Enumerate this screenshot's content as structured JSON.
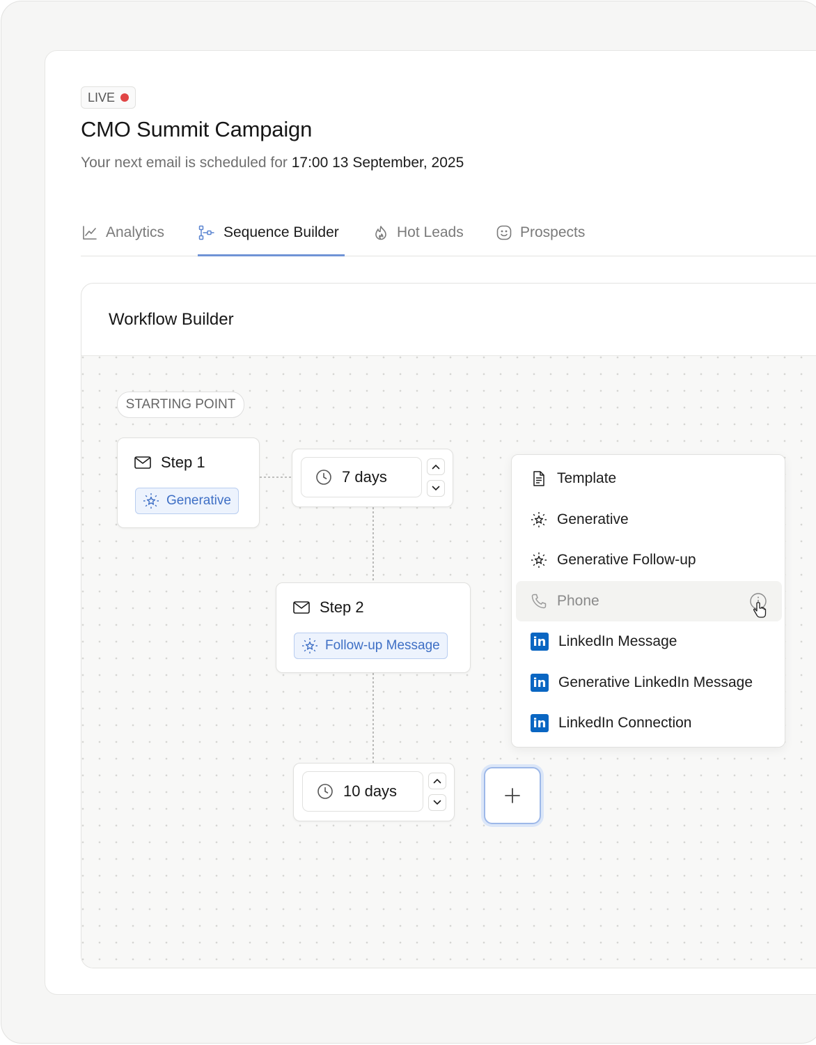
{
  "header": {
    "status_badge": "LIVE",
    "title": "CMO Summit Campaign",
    "schedule_prefix": "Your next email is scheduled for ",
    "schedule_time": "17:00 13 September, 2025"
  },
  "tabs": [
    {
      "label": "Analytics",
      "icon": "line-chart-icon",
      "active": false
    },
    {
      "label": "Sequence Builder",
      "icon": "workflow-icon",
      "active": true
    },
    {
      "label": "Hot Leads",
      "icon": "flame-icon",
      "active": false
    },
    {
      "label": "Prospects",
      "icon": "smiley-icon",
      "active": false
    }
  ],
  "workflow": {
    "title": "Workflow Builder",
    "starting_point": "STARTING POINT",
    "steps": [
      {
        "label": "Step 1",
        "tag": "Generative"
      },
      {
        "label": "Step 2",
        "tag": "Follow-up Message"
      }
    ],
    "delays": [
      "7 days",
      "10 days"
    ],
    "add_button": "+"
  },
  "menu": {
    "items": [
      {
        "label": "Template",
        "icon": "document-icon"
      },
      {
        "label": "Generative",
        "icon": "sparkle-star-icon"
      },
      {
        "label": "Generative Follow-up",
        "icon": "sparkle-star-icon"
      },
      {
        "label": "Phone",
        "icon": "phone-icon",
        "hovered": true
      },
      {
        "label": "LinkedIn Message",
        "icon": "linkedin-icon"
      },
      {
        "label": "Generative LinkedIn Message",
        "icon": "linkedin-icon"
      },
      {
        "label": "LinkedIn Connection",
        "icon": "linkedin-icon"
      }
    ]
  },
  "colors": {
    "accent": "#3e6fc5",
    "live_dot": "#e04545",
    "linkedin": "#0a66c2"
  }
}
